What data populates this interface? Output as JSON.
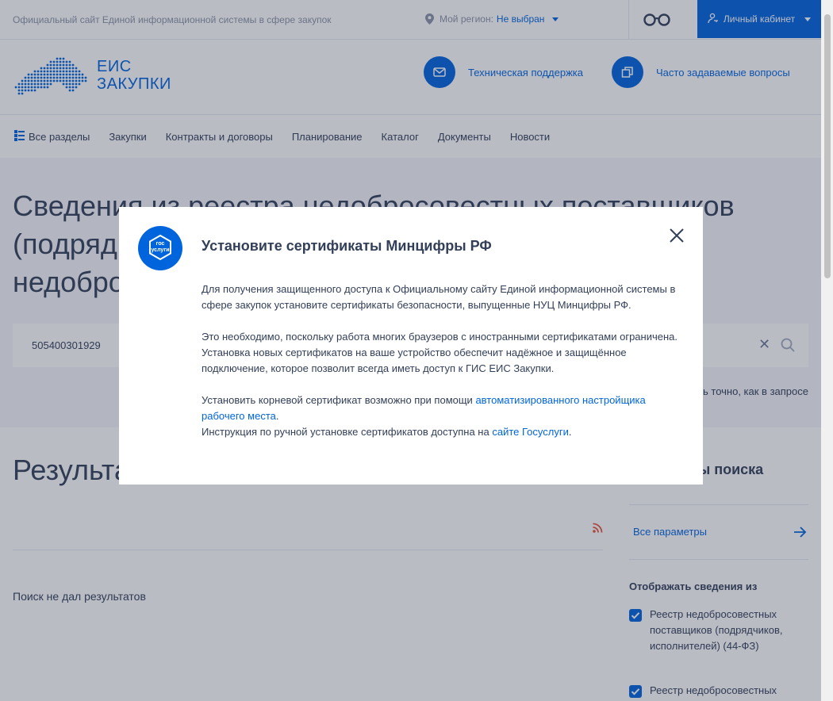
{
  "topbar": {
    "site_desc": "Официальный сайт Единой информационной системы в сфере закупок",
    "region_label": "Мой регион:",
    "region_value": "Не выбран",
    "cabinet_label": "Личный кабинет"
  },
  "header": {
    "logo_line1": "ЕИС",
    "logo_line2": "ЗАКУПКИ",
    "support_label": "Техническая поддержка",
    "faq_label": "Часто задаваемые вопросы"
  },
  "nav": {
    "items": [
      "Все разделы",
      "Закупки",
      "Контракты и договоры",
      "Планирование",
      "Каталог",
      "Документы",
      "Новости"
    ]
  },
  "search": {
    "title": "Сведения из реестра недобросовестных поставщиков (подрядчиков, исполнителей) и реестра недобросовестных подрядных организаций",
    "query": "505400301929",
    "exact_label": "Искать точно, как в запросе"
  },
  "results": {
    "title": "Результаты поиска",
    "no_results": "Поиск не дал результатов"
  },
  "sidebar": {
    "params_title": "Параметры поиска",
    "all_params": "Все параметры",
    "show_from": "Отображать сведения из",
    "checkbox1": "Реестр недобросовестных поставщиков (подрядчиков, исполнителей) (44-ФЗ)",
    "checkbox2": "Реестр недобросовестных"
  },
  "modal": {
    "icon_text_1": "гос",
    "icon_text_2": "услуги",
    "title": "Установите сертификаты Минцифры РФ",
    "p1": "Для получения защищенного доступа к Официальному сайту Единой информационной системы в сфере закупок установите сертификаты безопасности, выпущенные НУЦ Минцифры РФ.",
    "p2": "Это необходимо, поскольку работа многих браузеров с иностранными сертификатами ограничена. Установка новых сертификатов на ваше устройство обеспечит надёжное и защищённое подключение, которое позволит всегда иметь доступ к ГИС ЕИС Закупки.",
    "p3_text": "Установить корневой сертификат возможно при помощи ",
    "p3_link": "автоматизированного настройщика рабочего места",
    "p3_end": ".",
    "p4_text": "Инструкция по ручной установке сертификатов доступна на ",
    "p4_link": "сайте Госуслуги",
    "p4_end": "."
  },
  "colors": {
    "accent": "#0065dd",
    "text": "#334059",
    "muted": "#8a94a6",
    "band": "#f5f7fb",
    "rss": "#e8543a"
  }
}
